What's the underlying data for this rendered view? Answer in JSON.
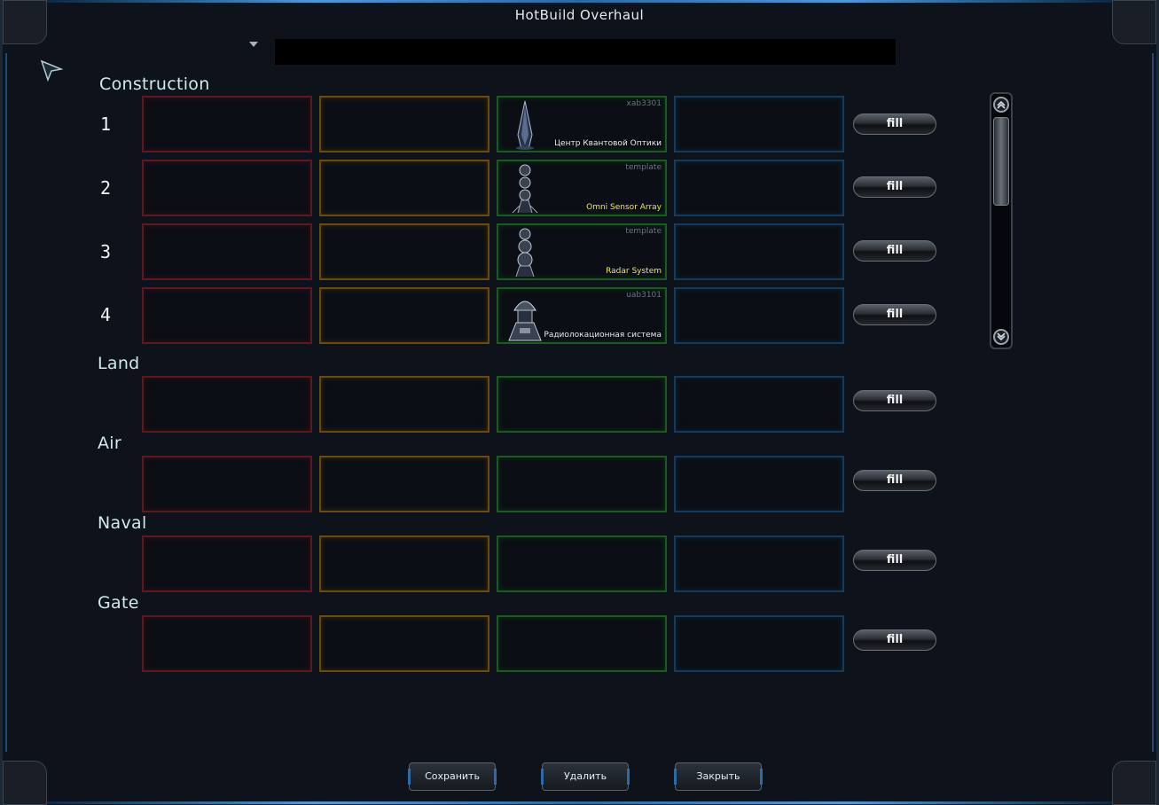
{
  "window": {
    "title": "HotBuild Overhaul"
  },
  "search": {
    "placeholder": ""
  },
  "sections": {
    "construction": {
      "label": "Construction"
    },
    "land": {
      "label": "Land"
    },
    "air": {
      "label": "Air"
    },
    "naval": {
      "label": "Naval"
    },
    "gate": {
      "label": "Gate"
    }
  },
  "rows": {
    "r1": {
      "num": "1",
      "code": "xab3301",
      "name": "Центр Квантовой Оптики",
      "icon": "spire-icon"
    },
    "r2": {
      "num": "2",
      "code": "template",
      "name": "Omni Sensor Array",
      "icon": "sensor-tower-icon"
    },
    "r3": {
      "num": "3",
      "code": "template",
      "name": "Radar System",
      "icon": "sensor-tower-icon"
    },
    "r4": {
      "num": "4",
      "code": "uab3101",
      "name": "Радиолокационная система",
      "icon": "radar-dome-icon"
    }
  },
  "fill_label": "fill",
  "buttons": {
    "save": "Сохранить",
    "delete": "Удалить",
    "close": "Закрыть"
  },
  "colors": {
    "slot_red": "#5a1a22",
    "slot_orange": "#6a4a10",
    "slot_green": "#1c5a22",
    "slot_blue": "#163a5c",
    "name_yellow": "#f0e848"
  }
}
